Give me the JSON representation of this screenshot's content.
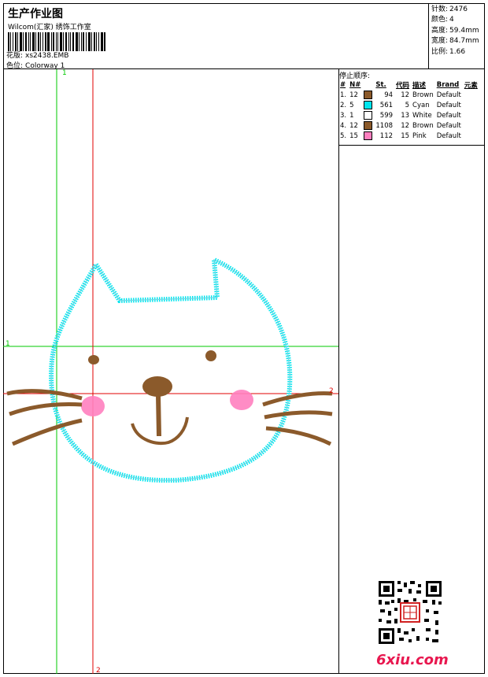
{
  "header": {
    "title": "生产作业图",
    "studio": "Wilcom(汇家) 绣饰工作室",
    "design_label": "花版:",
    "design_value": "xs2438.EMB",
    "colorway_label": "色位:",
    "colorway_value": "Colorway 1"
  },
  "stats": {
    "stitches_label": "针数:",
    "stitches_value": "2476",
    "colors_label": "颜色:",
    "colors_value": "4",
    "height_label": "高度:",
    "height_value": "59.4mm",
    "width_label": "宽度:",
    "width_value": "84.7mm",
    "scale_label": "比例:",
    "scale_value": "1.66"
  },
  "stop_sequence": {
    "title": "停止顺序:",
    "headers": [
      "#",
      "N#",
      "St.",
      "代码",
      "描述",
      "Brand",
      "元素"
    ],
    "rows": [
      {
        "index": "1.",
        "needle": "12",
        "color": "#8b5a2b",
        "stitches": "94",
        "code": "12",
        "desc": "Brown",
        "brand": "Default"
      },
      {
        "index": "2.",
        "needle": "5",
        "color": "#00e5ee",
        "stitches": "561",
        "code": "5",
        "desc": "Cyan",
        "brand": "Default"
      },
      {
        "index": "3.",
        "needle": "1",
        "color": "#ffffff",
        "stitches": "599",
        "code": "13",
        "desc": "White",
        "brand": "Default"
      },
      {
        "index": "4.",
        "needle": "12",
        "color": "#8b5a2b",
        "stitches": "1108",
        "code": "12",
        "desc": "Brown",
        "brand": "Default"
      },
      {
        "index": "5.",
        "needle": "15",
        "color": "#ff7fbf",
        "stitches": "112",
        "code": "15",
        "desc": "Pink",
        "brand": "Default"
      }
    ]
  },
  "canvas": {
    "axis_1_top": "1",
    "axis_1_left": "1",
    "axis_2_bottom": "2",
    "axis_2_right": "2"
  },
  "watermark": "6xiu.com",
  "colors": {
    "outline": "#00e5ee",
    "thread_brown": "#8b5a2b",
    "cheek_pink": "#ff7fbf",
    "guide_green": "#00c800",
    "guide_red": "#e00000"
  }
}
